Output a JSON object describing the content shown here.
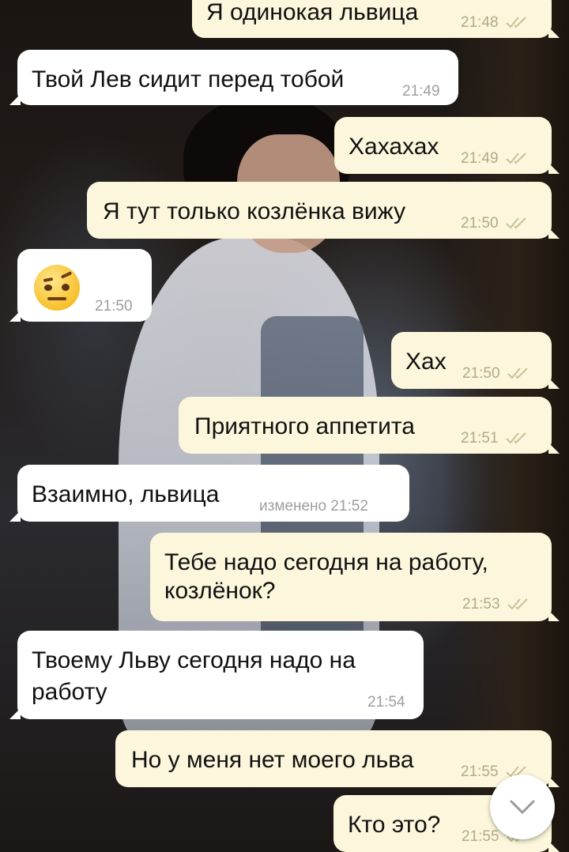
{
  "messages": [
    {
      "text": "Я одинокая львица",
      "time": "21:48",
      "direction": "out"
    },
    {
      "text": "Твой Лев сидит перед тобой",
      "time": "21:49",
      "direction": "in"
    },
    {
      "text": "Хахахах",
      "time": "21:49",
      "direction": "out"
    },
    {
      "text": "Я тут только козлёнка вижу",
      "time": "21:50",
      "direction": "out"
    },
    {
      "emoji": "face-with-raised-eyebrow",
      "time": "21:50",
      "direction": "in"
    },
    {
      "text": "Хах",
      "time": "21:50",
      "direction": "out"
    },
    {
      "text": "Приятного аппетита",
      "time": "21:51",
      "direction": "out"
    },
    {
      "text": "Взаимно, львица",
      "edited_label": "изменено",
      "time": "21:52",
      "direction": "in"
    },
    {
      "lines": [
        "Тебе надо сегодня на работу,",
        "козлёнок?"
      ],
      "time": "21:53",
      "direction": "out"
    },
    {
      "lines": [
        "Твоему Льву сегодня надо на",
        "работу"
      ],
      "time": "21:54",
      "direction": "in"
    },
    {
      "text": "Но у меня нет моего льва",
      "time": "21:55",
      "direction": "out"
    },
    {
      "text": "Кто это?",
      "time": "21:55",
      "direction": "out"
    }
  ],
  "scroll_button": {
    "icon": "chevron-down-icon"
  },
  "colors": {
    "outgoing_bubble": "#fcf7dc",
    "incoming_bubble": "#ffffff",
    "outgoing_meta": "#b2aa86",
    "read_ticks": "#c8c299",
    "incoming_meta": "#9e9e9e"
  }
}
